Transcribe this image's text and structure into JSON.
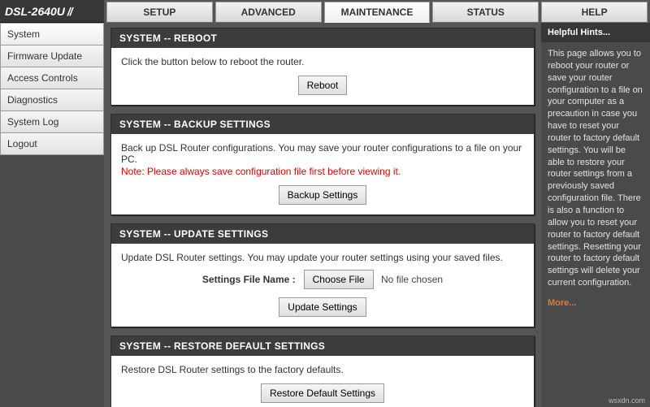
{
  "model": "DSL-2640U",
  "tabs": {
    "setup": "SETUP",
    "advanced": "ADVANCED",
    "maintenance": "MAINTENANCE",
    "status": "STATUS",
    "help": "HELP"
  },
  "sidebar": {
    "items": [
      {
        "label": "System"
      },
      {
        "label": "Firmware Update"
      },
      {
        "label": "Access Controls"
      },
      {
        "label": "Diagnostics"
      },
      {
        "label": "System Log"
      },
      {
        "label": "Logout"
      }
    ]
  },
  "reboot": {
    "title": "SYSTEM -- REBOOT",
    "text": "Click the button below to reboot the router.",
    "button": "Reboot"
  },
  "backup": {
    "title": "SYSTEM -- BACKUP SETTINGS",
    "text": "Back up DSL Router configurations. You may save your router configurations to a file on your PC.",
    "note": "Note: Please always save configuration file first before viewing it.",
    "button": "Backup Settings"
  },
  "update": {
    "title": "SYSTEM -- UPDATE SETTINGS",
    "text": "Update DSL Router settings. You may update your router settings using your saved files.",
    "file_label": "Settings File Name :",
    "choose": "Choose File",
    "no_file": "No file chosen",
    "button": "Update Settings"
  },
  "restore": {
    "title": "SYSTEM -- RESTORE DEFAULT SETTINGS",
    "text": "Restore DSL Router settings to the factory defaults.",
    "button": "Restore Default Settings"
  },
  "hints": {
    "title": "Helpful Hints...",
    "body": "This page allows you to reboot your router or save your router configuration to a file on your computer as a precaution in case you have to reset your router to factory default settings. You will be able to restore your router settings from a previously saved configuration file. There is also a function to allow you to reset your router to factory default settings. Resetting your router to factory default settings will delete your current configuration.",
    "more": "More..."
  },
  "watermark": "wsxdn.com"
}
